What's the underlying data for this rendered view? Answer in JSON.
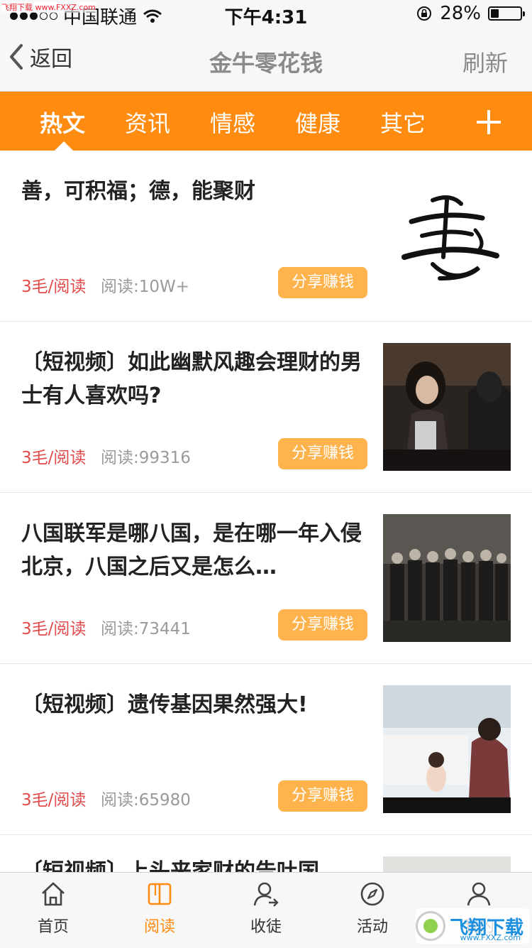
{
  "status_bar": {
    "watermark": "飞翔下载 www.FXXZ.com",
    "carrier": "中国联通",
    "time": "下午4:31",
    "battery": "28%",
    "battery_level": 0.28
  },
  "nav": {
    "back_label": "返回",
    "title": "金牛零花钱",
    "refresh_label": "刷新"
  },
  "tabs": [
    {
      "label": "热文",
      "active": true
    },
    {
      "label": "资讯"
    },
    {
      "label": "情感"
    },
    {
      "label": "健康"
    },
    {
      "label": "其它"
    }
  ],
  "articles": [
    {
      "title": "善，可积福；德，能聚财",
      "reward": "3毛/阅读",
      "reads": "阅读:10W+",
      "share_label": "分享赚钱",
      "thumb_icon": "calligraphy-shan-image",
      "thumb_text": "善"
    },
    {
      "title": "〔短视频〕如此幽默风趣会理财的男士有人喜欢吗?",
      "reward": "3毛/阅读",
      "reads": "阅读:99316",
      "share_label": "分享赚钱",
      "thumb_icon": "video-still-couple-image"
    },
    {
      "title": "八国联军是哪八国，是在哪一年入侵北京，八国之后又是怎么…",
      "reward": "3毛/阅读",
      "reads": "阅读:73441",
      "share_label": "分享赚钱",
      "thumb_icon": "historical-group-photo-image"
    },
    {
      "title": "〔短视频〕遗传基因果然强大!",
      "reward": "3毛/阅读",
      "reads": "阅读:65980",
      "share_label": "分享赚钱",
      "thumb_icon": "video-still-mother-baby-image"
    },
    {
      "title": "〔短视频〕上头来家财的告吐国",
      "thumb_icon": "partial-thumb-image"
    }
  ],
  "bottom_tabs": [
    {
      "label": "首页",
      "icon": "home-icon"
    },
    {
      "label": "阅读",
      "icon": "book-icon",
      "active": true
    },
    {
      "label": "收徒",
      "icon": "add-user-icon"
    },
    {
      "label": "活动",
      "icon": "compass-icon"
    },
    {
      "label": "我的",
      "icon": "profile-icon"
    }
  ],
  "brand_badge": {
    "text": "飞翔下载",
    "sub": "www.FXXZ.com"
  },
  "colors": {
    "accent": "#ff8c10",
    "share_button": "#ffb34d",
    "reward_text": "#e24b4b"
  }
}
